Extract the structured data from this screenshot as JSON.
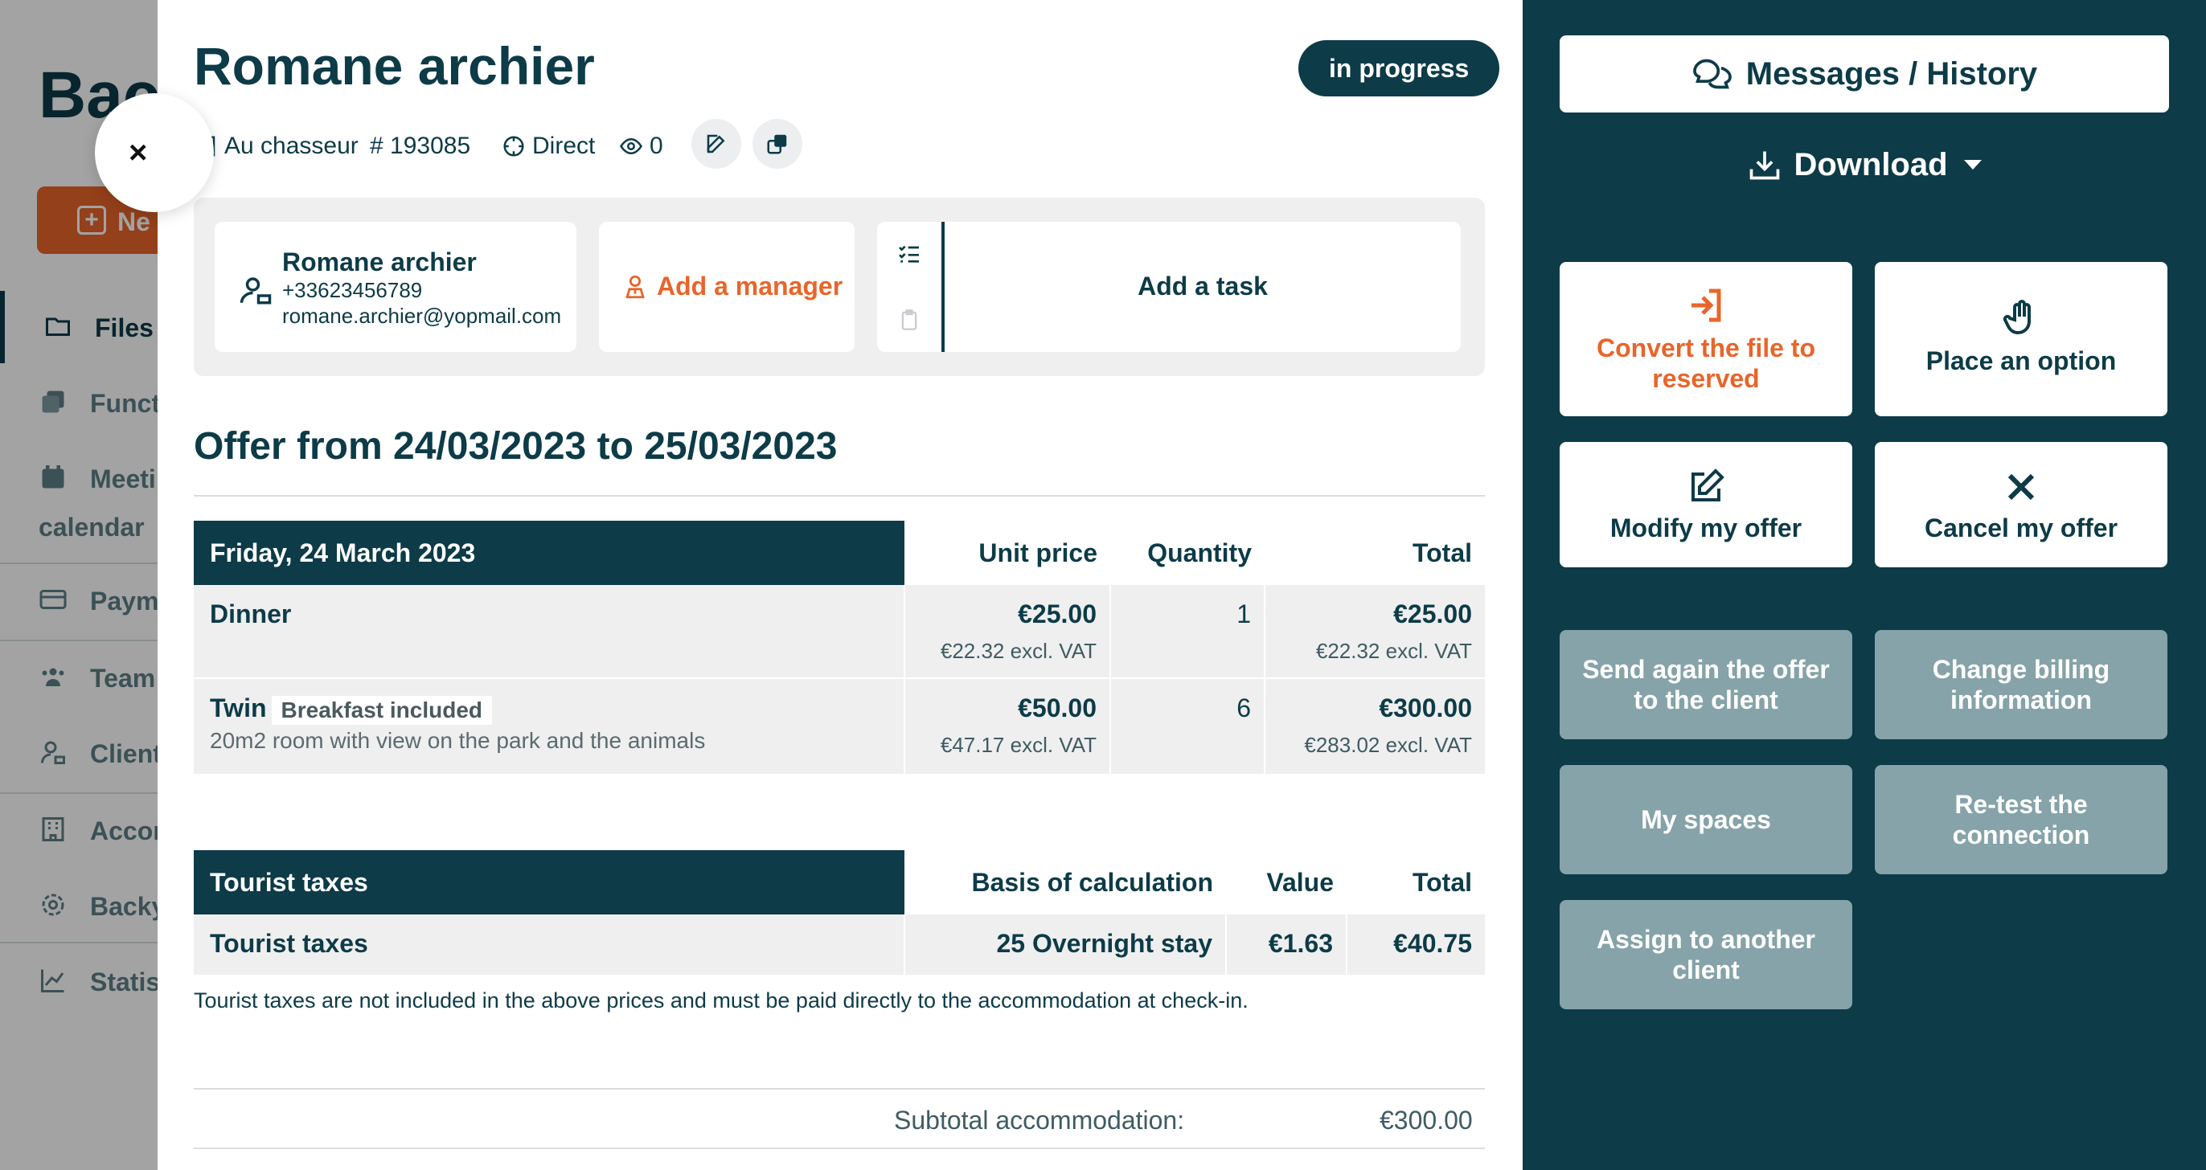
{
  "background_app": {
    "title_fragment": "Bac",
    "new_button_fragment": "Ne",
    "nav": [
      {
        "label": "Files",
        "icon": "folder-icon"
      },
      {
        "label": "Funct",
        "icon": "copy-icon"
      },
      {
        "label": "Meeti",
        "icon": "calendar-icon"
      },
      {
        "label": "calendar",
        "icon": ""
      },
      {
        "label": "Paym",
        "icon": "card-icon"
      },
      {
        "label": "Team",
        "icon": "team-icon"
      },
      {
        "label": "Client",
        "icon": "client-icon"
      },
      {
        "label": "Accom",
        "icon": "building-icon"
      },
      {
        "label": "Backy",
        "icon": "gear-icon"
      },
      {
        "label": "Statis",
        "icon": "chart-icon"
      }
    ]
  },
  "close_label": "×",
  "header": {
    "title": "Romane archier",
    "status": "in progress",
    "venue": "Au chasseur",
    "file_number": "# 193085",
    "channel": "Direct",
    "views": "0"
  },
  "contact": {
    "name": "Romane archier",
    "phone": "+33623456789",
    "email": "romane.archier@yopmail.com",
    "add_manager": "Add a manager",
    "add_task": "Add a task"
  },
  "offer": {
    "title": "Offer from 24/03/2023 to 25/03/2023",
    "day_header": "Friday, 24 March 2023",
    "columns": [
      "Unit price",
      "Quantity",
      "Total"
    ],
    "rows": [
      {
        "name": "Dinner",
        "tag": "",
        "description": "",
        "unit_price": "€25.00",
        "unit_price_excl": "€22.32 excl. VAT",
        "quantity": "1",
        "total": "€25.00",
        "total_excl": "€22.32 excl. VAT"
      },
      {
        "name": "Twin",
        "tag": "Breakfast included",
        "description": "20m2 room with view on the park and the animals",
        "unit_price": "€50.00",
        "unit_price_excl": "€47.17 excl. VAT",
        "quantity": "6",
        "total": "€300.00",
        "total_excl": "€283.02 excl. VAT"
      }
    ]
  },
  "taxes": {
    "header": "Tourist taxes",
    "columns": [
      "Basis of calculation",
      "Value",
      "Total"
    ],
    "row": {
      "name": "Tourist taxes",
      "basis": "25 Overnight stay",
      "value": "€1.63",
      "total": "€40.75"
    },
    "note": "Tourist taxes are not included in the above prices and must be paid directly to the accommodation at check-in."
  },
  "summary": {
    "subtotal_label": "Subtotal accommodation:",
    "subtotal_value": "€300.00"
  },
  "sidebar": {
    "messages": "Messages / History",
    "download": "Download",
    "actions": [
      {
        "label": "Convert the file to reserved",
        "icon": "login-arrow-icon"
      },
      {
        "label": "Place an option",
        "icon": "hand-icon"
      },
      {
        "label": "Modify my offer",
        "icon": "edit-icon"
      },
      {
        "label": "Cancel my offer",
        "icon": "close-icon"
      }
    ],
    "secondary": [
      "Send again the offer to the client",
      "Change billing information",
      "My spaces",
      "Re-test the connection",
      "Assign to another client"
    ]
  },
  "colors": {
    "primary": "#0d3b48",
    "accent": "#e8652a",
    "muted_button": "#85a3a8",
    "panel_gray": "#efefef"
  }
}
